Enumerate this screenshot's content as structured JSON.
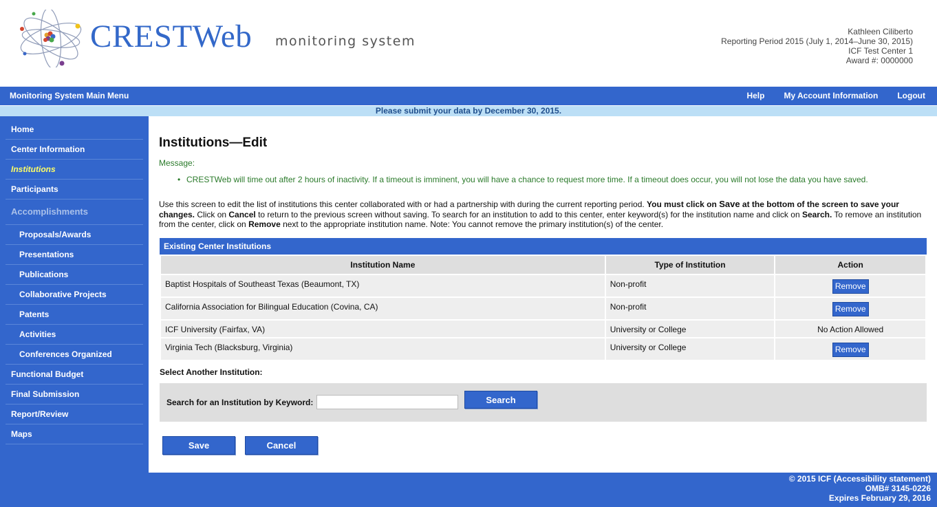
{
  "header": {
    "logo_text": "CRESTWeb",
    "tagline": "monitoring system",
    "user_name": "Kathleen Ciliberto",
    "reporting_period": "Reporting Period 2015 (July 1, 2014–June 30, 2015)",
    "center": "ICF Test Center 1",
    "award": "Award #: 0000000"
  },
  "topbar": {
    "main_menu": "Monitoring System Main Menu",
    "help": "Help",
    "account": "My Account Information",
    "logout": "Logout"
  },
  "notice": "Please submit your data by December 30, 2015.",
  "sidebar": {
    "items": [
      {
        "label": "Home"
      },
      {
        "label": "Center Information"
      },
      {
        "label": "Institutions"
      },
      {
        "label": "Participants"
      },
      {
        "label": "Accomplishments"
      },
      {
        "label": "Proposals/Awards"
      },
      {
        "label": "Presentations"
      },
      {
        "label": "Publications"
      },
      {
        "label": "Collaborative Projects"
      },
      {
        "label": "Patents"
      },
      {
        "label": "Activities"
      },
      {
        "label": "Conferences Organized"
      },
      {
        "label": "Functional Budget"
      },
      {
        "label": "Final Submission"
      },
      {
        "label": "Report/Review"
      },
      {
        "label": "Maps"
      }
    ]
  },
  "main": {
    "title": "Institutions—Edit",
    "message_label": "Message:",
    "message": "CRESTWeb will time out after 2 hours of inactivity. If a timeout is imminent, you will have a chance to request more time. If a timeout does occur, you will not lose the data you have saved.",
    "instructions": {
      "p1": "Use this screen to edit the list of institutions this center collaborated with or had a partnership with during the current reporting period. ",
      "b1": "You must click on ",
      "b2": "Save",
      "b3": " at the bottom of the screen to save your changes.",
      "p2": " Click on ",
      "b4": "Cancel",
      "p3": " to return to the previous screen without saving. To search for an institution to add to this center, enter keyword(s) for the institution name and click on ",
      "b5": "Search.",
      "p4": " To remove an institution from the center, click on ",
      "b6": "Remove",
      "p5": " next to the appropriate institution name. Note: You cannot remove the primary institution(s) of the center."
    }
  },
  "table": {
    "caption": "Existing Center Institutions",
    "columns": [
      "Institution Name",
      "Type of Institution",
      "Action"
    ],
    "rows": [
      {
        "name": "Baptist Hospitals of Southeast Texas (Beaumont, TX)",
        "type": "Non-profit",
        "action": "Remove"
      },
      {
        "name": "California Association for Bilingual Education (Covina, CA)",
        "type": "Non-profit",
        "action": "Remove"
      },
      {
        "name": "ICF University (Fairfax, VA)",
        "type": "University or College",
        "action": "No Action Allowed"
      },
      {
        "name": "Virginia Tech (Blacksburg, Virginia)",
        "type": "University or College",
        "action": "Remove"
      }
    ]
  },
  "search": {
    "section_label": "Select Another Institution:",
    "field_label": "Search for an Institution by Keyword:",
    "value": "",
    "button": "Search"
  },
  "buttons": {
    "save": "Save",
    "cancel": "Cancel"
  },
  "footer": {
    "copyright": "© 2015 ICF (Accessibility statement)",
    "omb": "OMB# 3145-0226",
    "expires": "Expires February 29, 2016"
  },
  "colors": {
    "primary": "#3366cc",
    "notice_bg": "#bcdff6",
    "message": "#2a7a2a",
    "active_nav": "#ffff66"
  }
}
